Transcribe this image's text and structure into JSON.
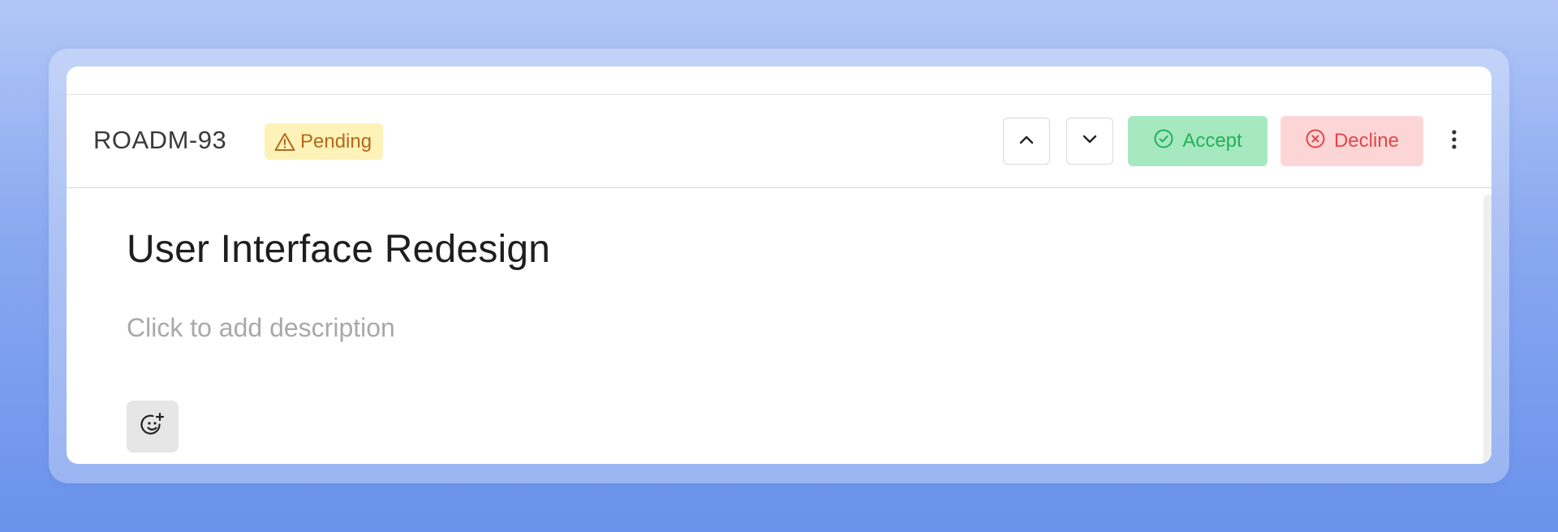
{
  "issue": {
    "id": "ROADM-93",
    "status": "Pending",
    "title": "User Interface Redesign",
    "description_placeholder": "Click to add description"
  },
  "actions": {
    "accept_label": "Accept",
    "decline_label": "Decline"
  },
  "icons": {
    "status": "warning-triangle-icon",
    "prev": "chevron-up-icon",
    "next": "chevron-down-icon",
    "accept": "check-circle-icon",
    "decline": "x-circle-icon",
    "more": "vertical-ellipsis-icon",
    "reaction": "add-emoji-icon"
  },
  "colors": {
    "background": "#6a92ec",
    "pending_bg": "#fdf2b8",
    "pending_text": "#b5691b",
    "accept_bg": "#a6e9c1",
    "accept_text": "#22b157",
    "decline_bg": "#fcd6d6",
    "decline_text": "#e4454a"
  }
}
